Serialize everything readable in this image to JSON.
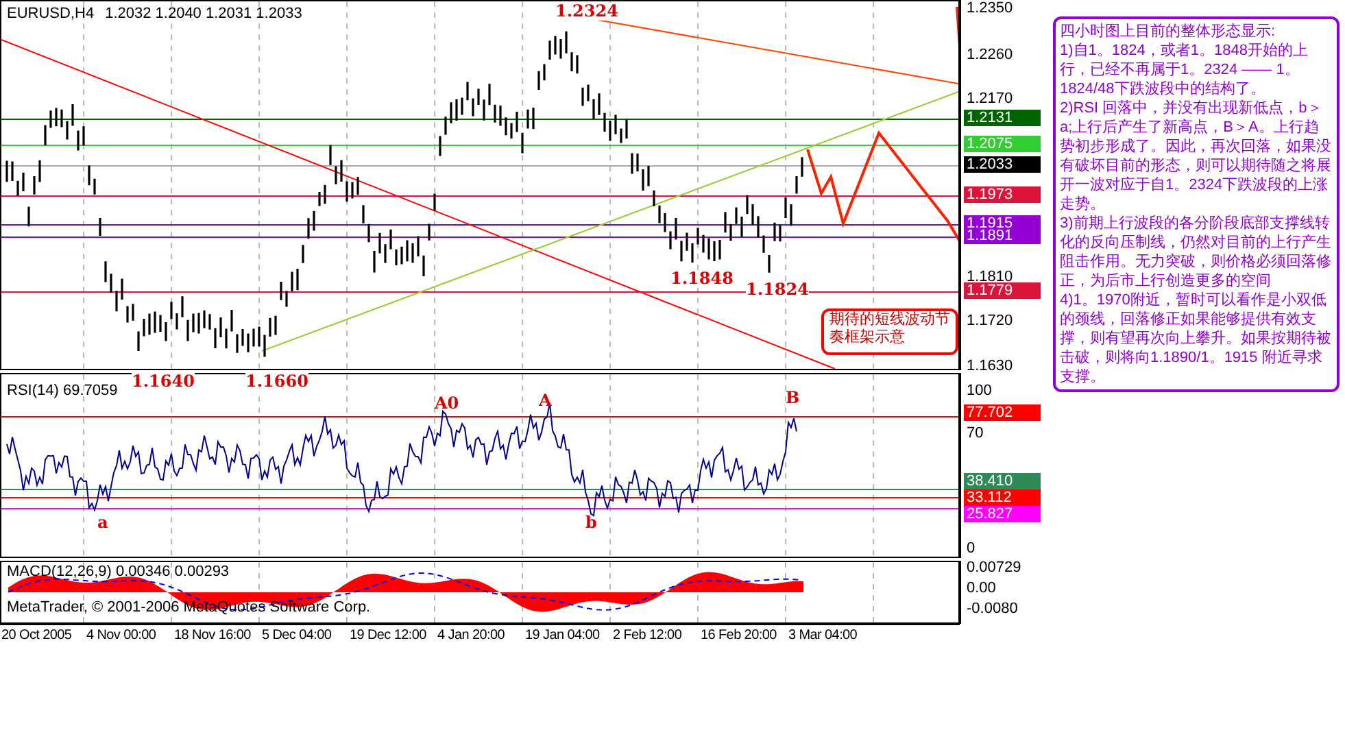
{
  "header": {
    "symbol": "EURUSD,H4",
    "quotes": "1.2032 1.2040 1.2031 1.2033"
  },
  "price_chart": {
    "labels": [
      "1.2324",
      "1.1848",
      "1.1824",
      "1.1640",
      "1.1660"
    ],
    "note": {
      "lines": [
        "期待的短线波动节",
        "奏框架示意"
      ]
    }
  },
  "price_axis": {
    "ticks": [
      "1.2350",
      "1.2260",
      "1.2170",
      "1.1810",
      "1.1720",
      "1.1630"
    ],
    "tags": [
      {
        "text": "1.2131",
        "color": "#006400"
      },
      {
        "text": "1.2075",
        "color": "#32cd32"
      },
      {
        "text": "1.2033",
        "color": "#000000"
      },
      {
        "text": "1.1973",
        "color": "#dc143c"
      },
      {
        "text": "1.1915",
        "color": "#9400d3"
      },
      {
        "text": "1.1891",
        "color": "#9400d3"
      },
      {
        "text": "1.1779",
        "color": "#dc143c"
      }
    ]
  },
  "rsi": {
    "title": "RSI(14) 69.7059",
    "labels": [
      "A0",
      "A",
      "B",
      "a",
      "b"
    ],
    "ticks": [
      "100",
      "70",
      "0"
    ],
    "tags": [
      {
        "text": "77.702",
        "color": "#ff0000"
      },
      {
        "text": "38.410",
        "color": "#2e8b57"
      },
      {
        "text": "33.112",
        "color": "#ff0000"
      },
      {
        "text": "25.827",
        "color": "#ff00ff"
      }
    ]
  },
  "macd": {
    "title": "MACD(12,26,9) 0.00346 0.00293",
    "copyright": "MetaTrader, © 2001-2006 MetaQuotes Software Corp.",
    "ticks": [
      "0.00729",
      "0.00",
      "-0.0080"
    ]
  },
  "time_axis": [
    "20 Oct 2005",
    "4 Nov 00:00",
    "18 Nov 16:00",
    "5 Dec 04:00",
    "19 Dec 12:00",
    "4 Jan 20:00",
    "19 Jan 04:00",
    "2 Feb 12:00",
    "16 Feb 20:00",
    "3 Mar 04:00"
  ],
  "commentary": {
    "title": "四小时图上目前的整体形态显示:",
    "paragraphs": [
      "1)自1。1824，或者1。1848开始的上行，已经不再属于1。2324 —— 1。1824/48下跌波段中的结构了。",
      "2)RSI 回落中，并没有出现新低点，b＞a;上行后产生了新高点，B＞A。上行趋势初步形成了。因此，再次回落，如果没有破坏目前的形态，则可以期待随之将展开一波对应于自1。2324下跌波段的上涨走势。",
      "3)前期上行波段的各分阶段底部支撑线转化的反向压制线，仍然对目前的上行产生阻击作用。无力突破，则价格必须回落修正，为后市上行创造更多的空间",
      "4)1。1970附近，暂时可以看作是小双低的颈线，回落修正如果能够提供有效支撑，则有望再次向上攀升。如果按期待被击破，则将向1.1890/1。1915 附近寻求支撑。"
    ]
  }
}
